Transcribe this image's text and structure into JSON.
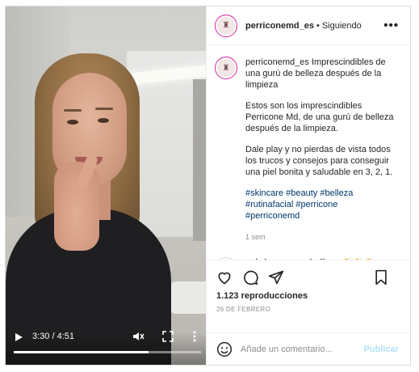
{
  "video": {
    "time": "3:30 / 4:51",
    "progress": 0.72,
    "icons": [
      "play-icon",
      "mute-icon",
      "fullscreen-icon",
      "more-vertical-icon"
    ]
  },
  "header": {
    "username": "perriconemd_es",
    "separator": "•",
    "follow_status": "Siguiendo",
    "more": "•••",
    "avatar_text": "♜"
  },
  "caption": {
    "username": "perriconemd_es",
    "title": "Imprescindibles de una gurú de belleza después de la limpieza",
    "paragraph1": "Estos son los imprescindibles Perricone Md, de una gurú de belleza después de la limpieza.",
    "paragraph2": "Dale play y no pierdas de vista todos los trucos y consejos para conseguir una piel bonita y saludable en 3, 2, 1.",
    "hashtags": [
      "#skincare",
      "#beauty",
      "#belleza",
      "#rutinafacial",
      "#perricone",
      "#perriconemd"
    ],
    "age": "1 sem"
  },
  "comment": {
    "username": "sabrinanavarrobelleza",
    "text": "👏👏👏👏👏",
    "avatar_text": "SN"
  },
  "actions": {
    "views": "1.123 reproducciones",
    "date": "26 DE FEBRERO"
  },
  "add_comment": {
    "placeholder": "Añade un comentario...",
    "publish": "Publicar"
  }
}
